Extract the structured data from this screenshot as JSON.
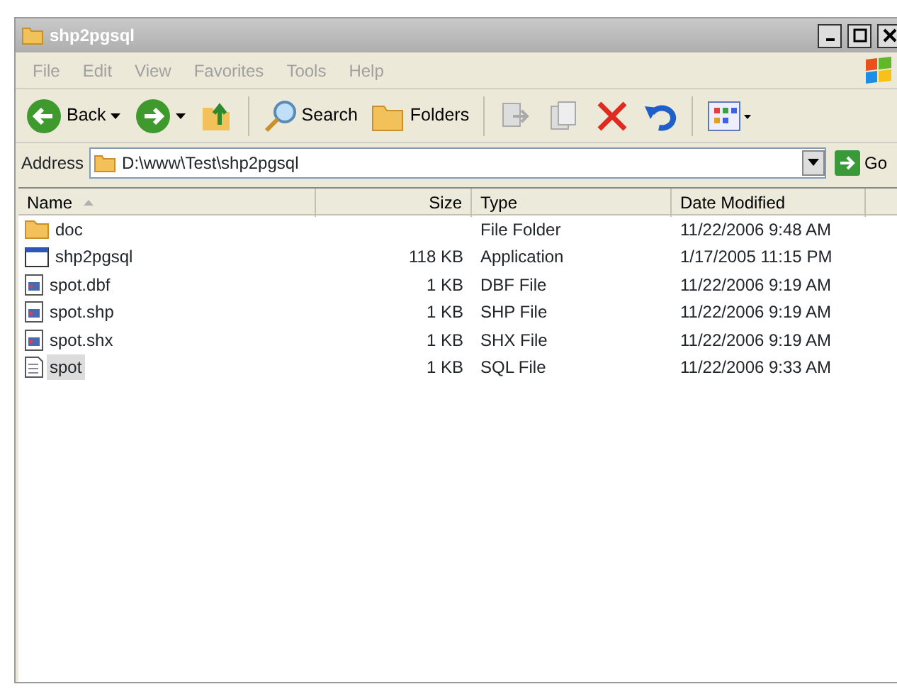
{
  "window": {
    "title": "shp2pgsql"
  },
  "menu": [
    "File",
    "Edit",
    "View",
    "Favorites",
    "Tools",
    "Help"
  ],
  "toolbar": [
    {
      "kind": "back",
      "label": "Back"
    },
    {
      "kind": "forward"
    },
    {
      "kind": "up"
    },
    {
      "kind": "search",
      "label": "Search"
    },
    {
      "kind": "folders",
      "label": "Folders"
    },
    {
      "kind": "moveto"
    },
    {
      "kind": "copyto"
    },
    {
      "kind": "delete"
    },
    {
      "kind": "undo"
    },
    {
      "kind": "views"
    }
  ],
  "address": {
    "label": "Address",
    "value": "D:\\www\\Test\\shp2pgsql",
    "go": "Go"
  },
  "table": {
    "columns": [
      "Name",
      "Size",
      "Type",
      "Date Modified"
    ],
    "rows": [
      {
        "kind": "folder",
        "name": "doc",
        "size": "",
        "type": "File Folder",
        "date": "11/22/2006 9:48 AM",
        "selected": false
      },
      {
        "kind": "app",
        "name": "shp2pgsql",
        "size": "118 KB",
        "type": "Application",
        "date": "1/17/2005 11:15 PM",
        "selected": false
      },
      {
        "kind": "data",
        "name": "spot.dbf",
        "size": "1 KB",
        "type": "DBF File",
        "date": "11/22/2006 9:19 AM",
        "selected": false
      },
      {
        "kind": "data",
        "name": "spot.shp",
        "size": "1 KB",
        "type": "SHP File",
        "date": "11/22/2006 9:19 AM",
        "selected": false
      },
      {
        "kind": "data",
        "name": "spot.shx",
        "size": "1 KB",
        "type": "SHX File",
        "date": "11/22/2006 9:19 AM",
        "selected": false
      },
      {
        "kind": "text",
        "name": "spot",
        "size": "1 KB",
        "type": "SQL File",
        "date": "11/22/2006 9:33 AM",
        "selected": true
      }
    ]
  }
}
